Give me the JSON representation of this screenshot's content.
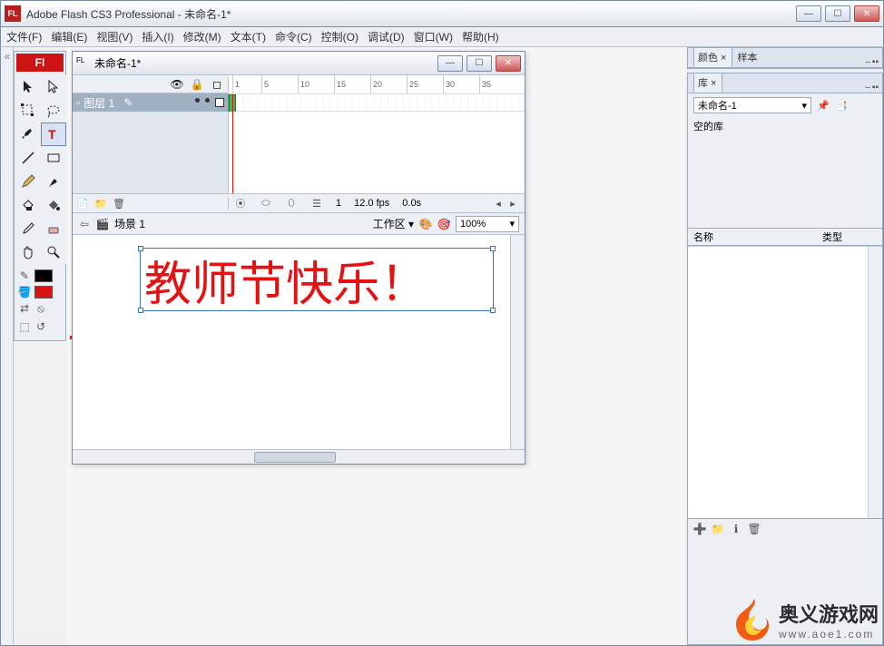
{
  "title": "Adobe Flash CS3 Professional - 未命名-1*",
  "app_badge": "FL",
  "menu": [
    "文件(F)",
    "编辑(E)",
    "视图(V)",
    "插入(I)",
    "修改(M)",
    "文本(T)",
    "命令(C)",
    "控制(O)",
    "调试(D)",
    "窗口(W)",
    "帮助(H)"
  ],
  "toolbox_label": "Fl",
  "document": {
    "tab_title": "未命名-1*",
    "layer_name": "图层 1",
    "ruler_ticks": [
      "1",
      "5",
      "10",
      "15",
      "20",
      "25",
      "30",
      "35"
    ],
    "status": {
      "frame": "1",
      "fps": "12.0 fps",
      "time": "0.0s"
    },
    "editbar": {
      "scene": "场景 1",
      "workspace": "工作区 ▾",
      "zoom": "100%"
    },
    "stage_text": "教师节快乐！"
  },
  "panels": {
    "color_tab": "颜色 ×",
    "swatch_tab": "样本",
    "library_tab": "库 ×",
    "library_doc": "未命名-1",
    "library_empty": "空的库",
    "col_name": "名称",
    "col_type": "类型"
  },
  "watermark": {
    "brand": "奥义游戏网",
    "url": "www.aoe1.com"
  }
}
